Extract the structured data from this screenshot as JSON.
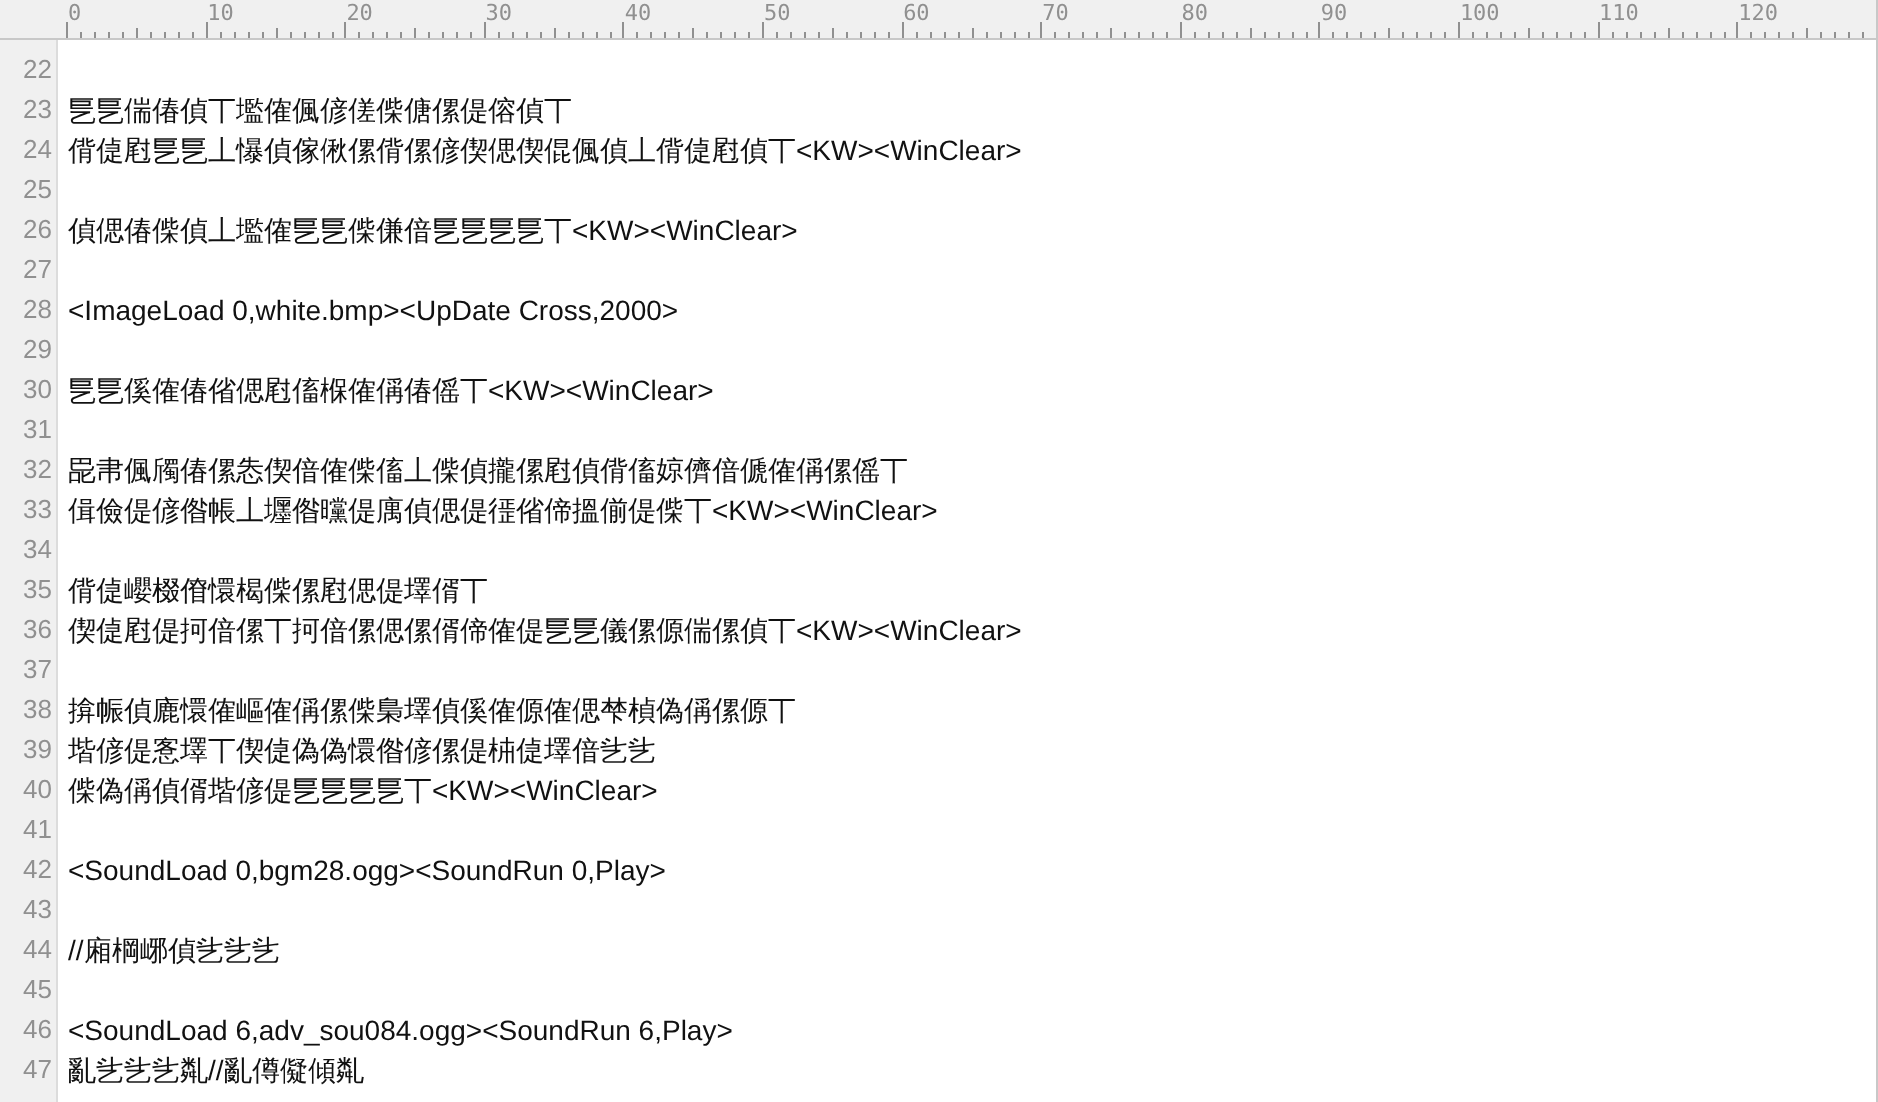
{
  "ruler": {
    "labels": [
      "0",
      "10",
      "20",
      "30",
      "40",
      "50",
      "60",
      "70",
      "80",
      "90",
      "100",
      "110",
      "120"
    ]
  },
  "lines": [
    {
      "number": "22"
    },
    {
      "number": "23",
      "text": "乬乬偳偆偵丅壏傕偑偐傞偨傏傫偍傛偵丅"
    },
    {
      "number": "24",
      "text": "偝偼屗乬乬丄懪偵傢偢傫偝傫偐偰偲偰倱偑偵丄偝偼屗偵丅<KW><WinClear>"
    },
    {
      "number": "25"
    },
    {
      "number": "26",
      "text": "偵偲偆偨偵丄壏傕乬乬偨傔偣乬乬乬乬丅<KW><WinClear>"
    },
    {
      "number": "27"
    },
    {
      "number": "28",
      "text": "<ImageLoad 0,white.bmp><UpDate Cross,2000>"
    },
    {
      "number": "29"
    },
    {
      "number": "30",
      "text": "乬乬傒傕偆偗偲屗傗椺傕偁偆傜丅<KW><WinClear>"
    },
    {
      "number": "31"
    },
    {
      "number": "32",
      "text": "巼帇偑斶偆傫怣偰偣傕偨傗丄偨偵攏傫屗偵偝傗婛儕偣傂傕偁傫傜丅"
    },
    {
      "number": "33",
      "text": "偮儉偍偐偺帳丄壥偺曭偍庽偵偲偍徰偗偙搵偂偍偨丅<KW><WinClear>"
    },
    {
      "number": "34"
    },
    {
      "number": "35",
      "text": "偝偼巊棳傄懁楬偨傫屗偲偍墿偦丅"
    },
    {
      "number": "36",
      "text": "偰偼屗偍抲偣傫丅抲偣傫偲傫偦偙傕偍乬乬儀傫傆偳傫偵丅<KW><WinClear>"
    },
    {
      "number": "37"
    },
    {
      "number": "38",
      "text": "揜帪偵廘懁傕嶇傕偁傫偨梟墿偵傒傕傆傕偲梺楨偽偁傫傆丅"
    },
    {
      "number": "39",
      "text": "堦偐偍愙墿丅偰偼偽偽懁偺偐傫偍枾偼墿偣乧乧"
    },
    {
      "number": "40",
      "text": "偨偽偁偵偦堦偐偍乬乬乬乬丅<KW><WinClear>"
    },
    {
      "number": "41"
    },
    {
      "number": "42",
      "text": "<SoundLoad 0,bgm28.ogg><SoundRun 0,Play>"
    },
    {
      "number": "43"
    },
    {
      "number": "44",
      "text": "//廂棡峫偵乧乧乧"
    },
    {
      "number": "45"
    },
    {
      "number": "46",
      "text": "<SoundLoad 6,adv_sou084.ogg><SoundRun 6,Play>"
    },
    {
      "number": "47",
      "text": "亂乧乧乧亃//亂僔儗傾亃"
    }
  ]
}
